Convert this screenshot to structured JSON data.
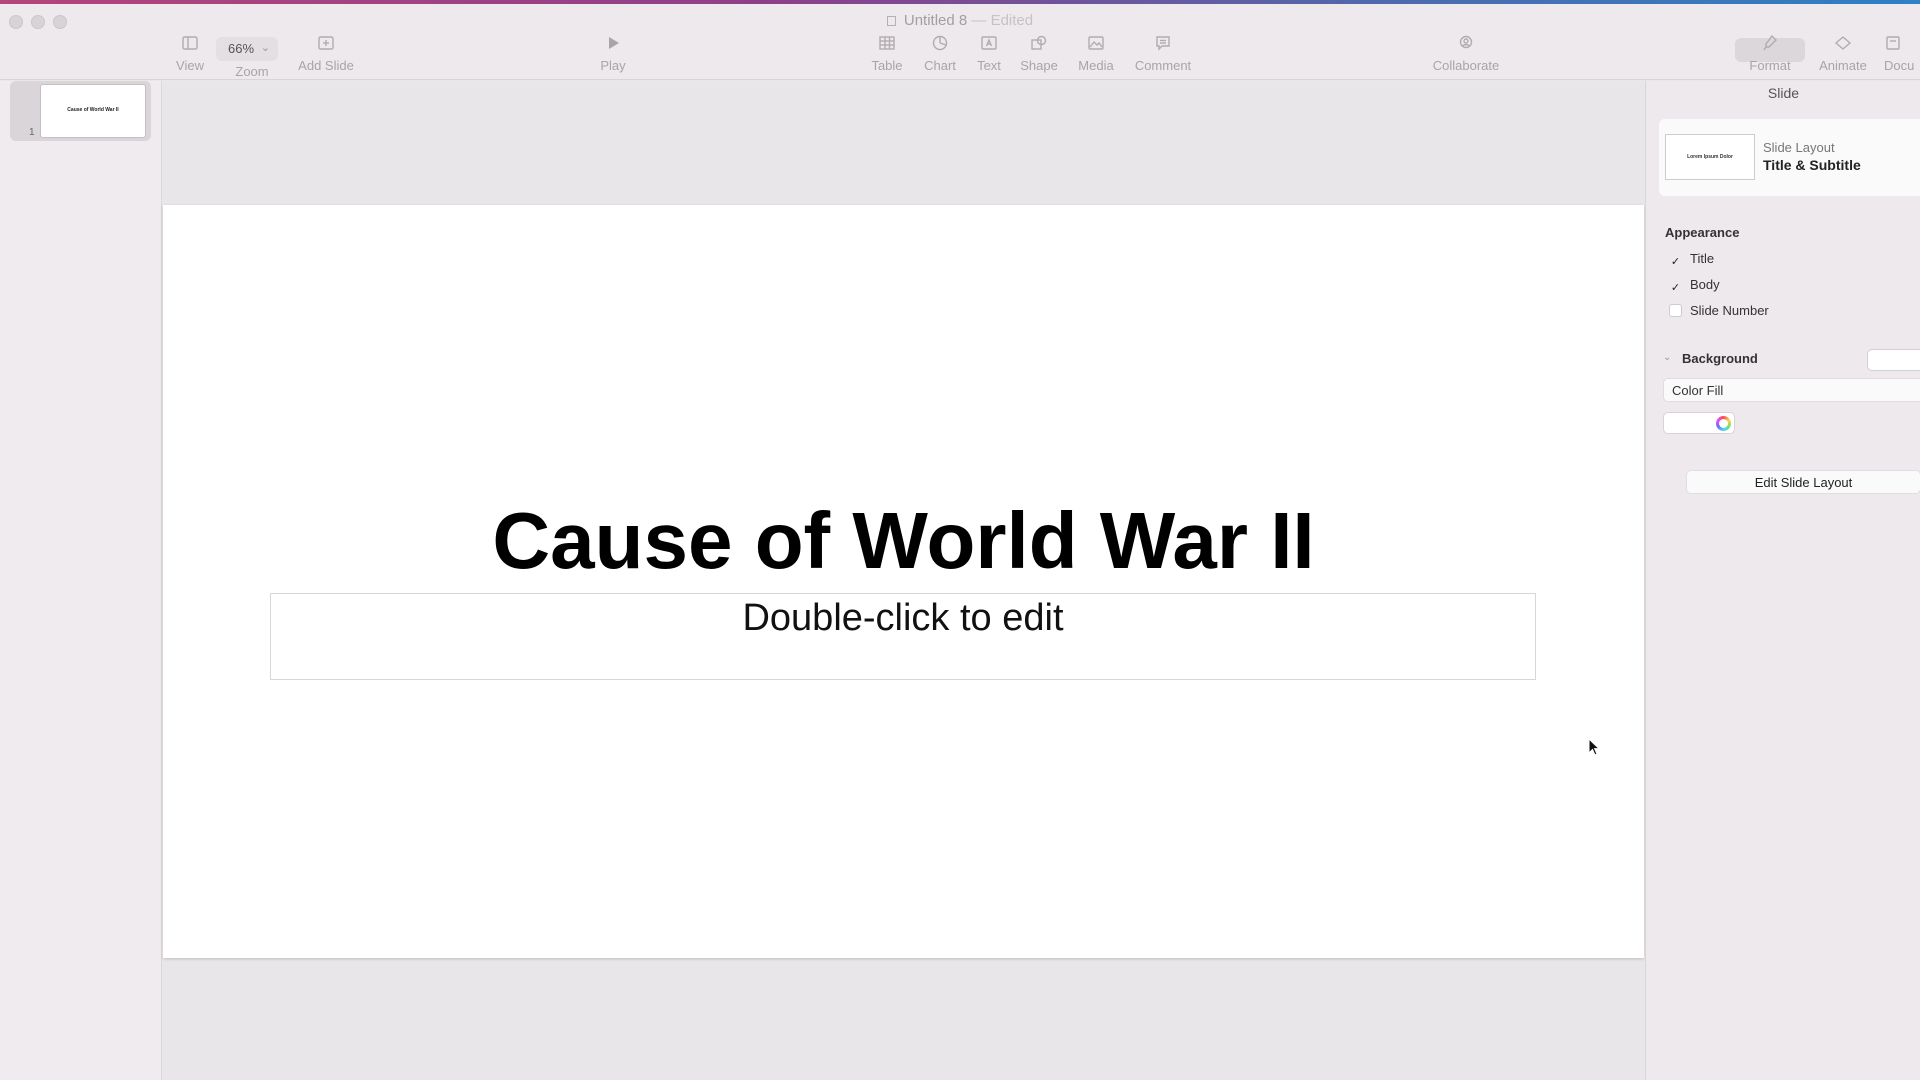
{
  "window": {
    "title": "Untitled 8",
    "separator": "—",
    "status": "Edited"
  },
  "toolbar": {
    "view": "View",
    "zoom_label": "Zoom",
    "zoom_value": "66%",
    "add_slide": "Add Slide",
    "play": "Play",
    "table": "Table",
    "chart": "Chart",
    "text": "Text",
    "shape": "Shape",
    "media": "Media",
    "comment": "Comment",
    "collaborate": "Collaborate",
    "format": "Format",
    "animate": "Animate",
    "document": "Docu"
  },
  "navigator": {
    "slides": [
      {
        "number": "1",
        "thumb_title": "Cause of World War II"
      }
    ]
  },
  "slide": {
    "title": "Cause of World War II",
    "subtitle": "Double-click to edit"
  },
  "inspector": {
    "tab": "Slide",
    "layout_caption": "Slide Layout",
    "layout_name": "Title & Subtitle",
    "layout_thumb_text": "Lorem Ipsum Dolor",
    "appearance_label": "Appearance",
    "appearance": [
      {
        "label": "Title",
        "checked": true
      },
      {
        "label": "Body",
        "checked": true
      },
      {
        "label": "Slide Number",
        "checked": false
      }
    ],
    "background_label": "Background",
    "fill_type": "Color Fill",
    "edit_layout_button": "Edit Slide Layout"
  },
  "colors": {
    "accent_gradient_start": "#b5457c",
    "accent_gradient_end": "#2f80c6",
    "slide_background": "#ffffff",
    "chrome_background": "#eee9ec"
  }
}
